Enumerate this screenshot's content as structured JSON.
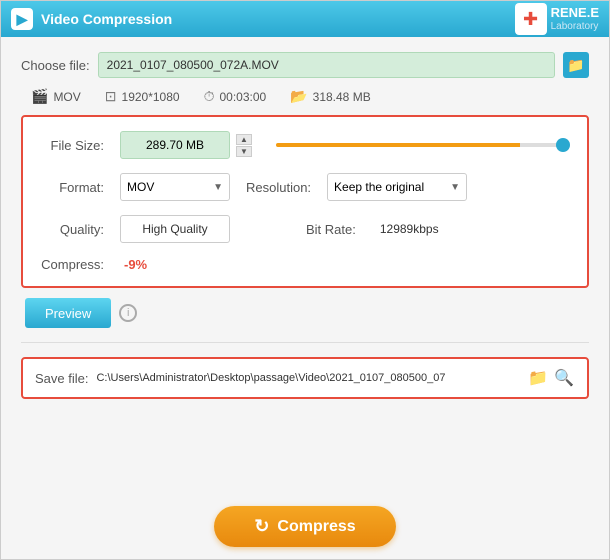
{
  "titleBar": {
    "title": "Video Compression",
    "icon": "▶",
    "logoText": "RENE.E",
    "logoSubText": "Laboratory"
  },
  "chooseFile": {
    "label": "Choose file:",
    "filePath": "2021_0107_080500_072A.MOV",
    "folderIconUnicode": "📁"
  },
  "fileInfo": {
    "format": "MOV",
    "resolution": "1920*1080",
    "duration": "00:03:00",
    "size": "318.48 MB"
  },
  "settings": {
    "fileSizeLabel": "File Size:",
    "fileSizeValue": "289.70 MB",
    "formatLabel": "Format:",
    "formatValue": "MOV",
    "resolutionLabel": "Resolution:",
    "resolutionValue": "Keep the original",
    "qualityLabel": "Quality:",
    "qualityValue": "High Quality",
    "bitRateLabel": "Bit Rate:",
    "bitRateValue": "12989kbps",
    "compressLabel": "Compress:",
    "compressValue": "-9%",
    "sliderPercent": 85
  },
  "preview": {
    "buttonLabel": "Preview",
    "infoSymbol": "i"
  },
  "saveFile": {
    "label": "Save file:",
    "path": "C:\\Users\\Administrator\\Desktop\\passage\\Video\\2021_0107_080500_07"
  },
  "compressButton": {
    "label": "Compress",
    "icon": "↻"
  }
}
